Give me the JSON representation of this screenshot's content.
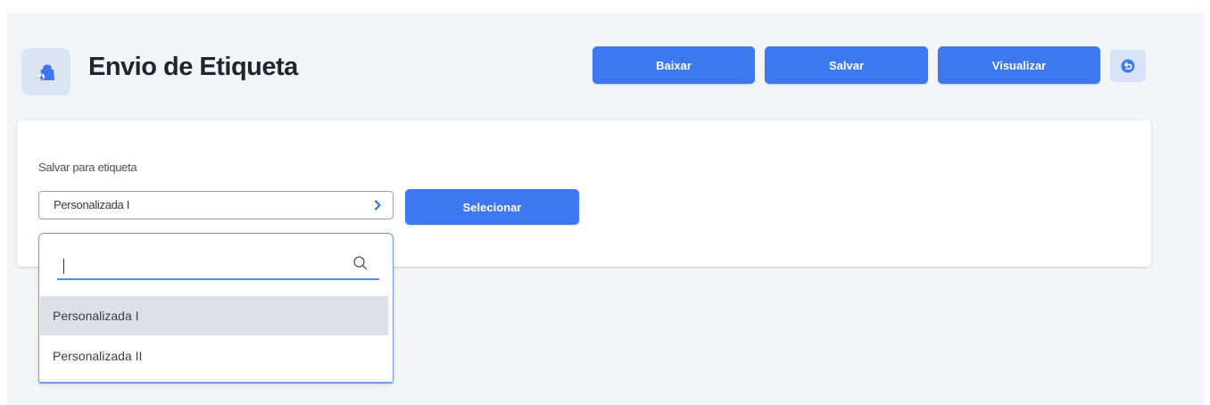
{
  "header": {
    "title": "Envio de Etiqueta",
    "app_icon": "bag-icon",
    "buttons": {
      "baixar": "Baixar",
      "salvar": "Salvar",
      "visualizar": "Visualizar"
    },
    "undo_icon": "undo-icon"
  },
  "form": {
    "label": "Salvar para etiqueta",
    "select_value": "Personalizada I",
    "select_button": "Selecionar"
  },
  "dropdown": {
    "search_value": "",
    "search_icon": "search-icon",
    "options": [
      "Personalizada I",
      "Personalizada II"
    ],
    "highlighted_index": 0
  },
  "colors": {
    "primary": "#3d78ee",
    "background": "#f3f5f9",
    "icon_tint": "#dbe4f3",
    "focus_border": "#6f9ee8",
    "highlight": "#dcdfe5"
  }
}
